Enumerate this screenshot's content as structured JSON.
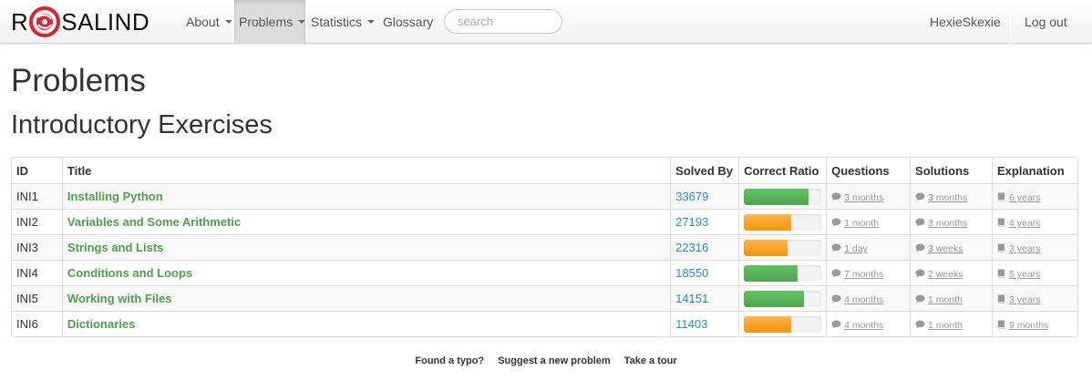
{
  "brand": {
    "letter_left": "R",
    "letters_right": "SALIND"
  },
  "nav": {
    "items": [
      {
        "label": "About",
        "dropdown": true
      },
      {
        "label": "Problems",
        "dropdown": true,
        "active": true
      },
      {
        "label": "Statistics",
        "dropdown": true
      },
      {
        "label": "Glossary",
        "dropdown": false
      }
    ],
    "search_placeholder": "search",
    "username": "HexieSkexie",
    "logout_label": "Log out"
  },
  "page_title": "Problems",
  "section_title": "Introductory Exercises",
  "table": {
    "headers": [
      "ID",
      "Title",
      "Solved By",
      "Correct Ratio",
      "Questions",
      "Solutions",
      "Explanation"
    ],
    "rows": [
      {
        "id": "INI1",
        "title": "Installing Python",
        "solved_by": "33679",
        "ratio": 0.83,
        "ratio_color": "green",
        "questions": "3 months",
        "solutions": "3 months",
        "explanation": "6 years"
      },
      {
        "id": "INI2",
        "title": "Variables and Some Arithmetic",
        "solved_by": "27193",
        "ratio": 0.61,
        "ratio_color": "orange",
        "questions": "1 month",
        "solutions": "3 months",
        "explanation": "4 years"
      },
      {
        "id": "INI3",
        "title": "Strings and Lists",
        "solved_by": "22316",
        "ratio": 0.56,
        "ratio_color": "orange",
        "questions": "1 day",
        "solutions": "3 weeks",
        "explanation": "3 years"
      },
      {
        "id": "INI4",
        "title": "Conditions and Loops",
        "solved_by": "18550",
        "ratio": 0.69,
        "ratio_color": "green",
        "questions": "7 months",
        "solutions": "2 weeks",
        "explanation": "5 years"
      },
      {
        "id": "INI5",
        "title": "Working with Files",
        "solved_by": "14151",
        "ratio": 0.78,
        "ratio_color": "green",
        "questions": "4 months",
        "solutions": "1 month",
        "explanation": "3 years"
      },
      {
        "id": "INI6",
        "title": "Dictionaries",
        "solved_by": "11403",
        "ratio": 0.61,
        "ratio_color": "orange",
        "questions": "4 months",
        "solutions": "1 month",
        "explanation": "9 months"
      }
    ]
  },
  "footer": {
    "links": [
      "Found a typo?",
      "Suggest a new problem",
      "Take a tour"
    ]
  },
  "colors": {
    "logo_red": "#d9232e",
    "title_green": "#4aa24a",
    "link_blue": "#1f8dd6",
    "bar_green": "#5cb85c",
    "bar_orange": "#f89406"
  },
  "icons": {
    "questions": "comment-icon",
    "solutions": "comment-icon",
    "explanation": "book-icon"
  }
}
